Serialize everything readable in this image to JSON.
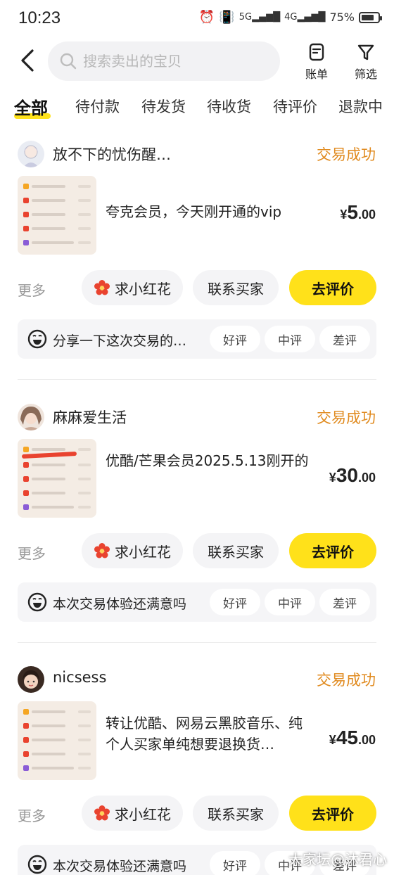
{
  "status_bar": {
    "time": "10:23",
    "battery": "75%",
    "battery_level": 0.75,
    "icons": [
      "alarm-icon",
      "vibrate-icon",
      "signal-5g-icon",
      "signal-4g-icon",
      "battery-icon"
    ]
  },
  "header": {
    "search_placeholder": "搜索卖出的宝贝",
    "bill_label": "账单",
    "filter_label": "筛选"
  },
  "tabs": [
    {
      "label": "全部",
      "active": true
    },
    {
      "label": "待付款"
    },
    {
      "label": "待发货"
    },
    {
      "label": "待收货"
    },
    {
      "label": "待评价"
    },
    {
      "label": "退款中"
    }
  ],
  "colors": {
    "accent_yellow": "#ffe11a",
    "status_orange": "#e08a1e",
    "flower_red": "#e9432f"
  },
  "orders": [
    {
      "seller": "放不下的忧伤醒…",
      "status": "交易成功",
      "title": "夸克会员，今天刚开通的vip",
      "price_currency": "¥",
      "price_int": "5",
      "price_dec": ".00",
      "more": "更多",
      "flower_label": "求小红花",
      "contact_label": "联系买家",
      "rate_label": "去评价",
      "feedback_text": "分享一下这次交易的…",
      "good": "好评",
      "mid": "中评",
      "bad": "差评"
    },
    {
      "seller": "麻麻爱生活",
      "status": "交易成功",
      "title": "优酷/芒果会员2025.5.13刚开的",
      "price_currency": "¥",
      "price_int": "30",
      "price_dec": ".00",
      "more": "更多",
      "flower_label": "求小红花",
      "contact_label": "联系买家",
      "rate_label": "去评价",
      "feedback_text": "本次交易体验还满意吗",
      "good": "好评",
      "mid": "中评",
      "bad": "差评"
    },
    {
      "seller": "nicsess",
      "status": "交易成功",
      "title": "转让优酷、网易云黑胶音乐、纯个人买家单纯想要退换货…",
      "price_currency": "¥",
      "price_int": "45",
      "price_dec": ".00",
      "more": "更多",
      "flower_label": "求小红花",
      "contact_label": "联系买家",
      "rate_label": "去评价",
      "feedback_text": "本次交易体验还满意吗",
      "good": "好评",
      "mid": "中评",
      "bad": "差评"
    }
  ],
  "watermark": "大家坛@沐君心"
}
